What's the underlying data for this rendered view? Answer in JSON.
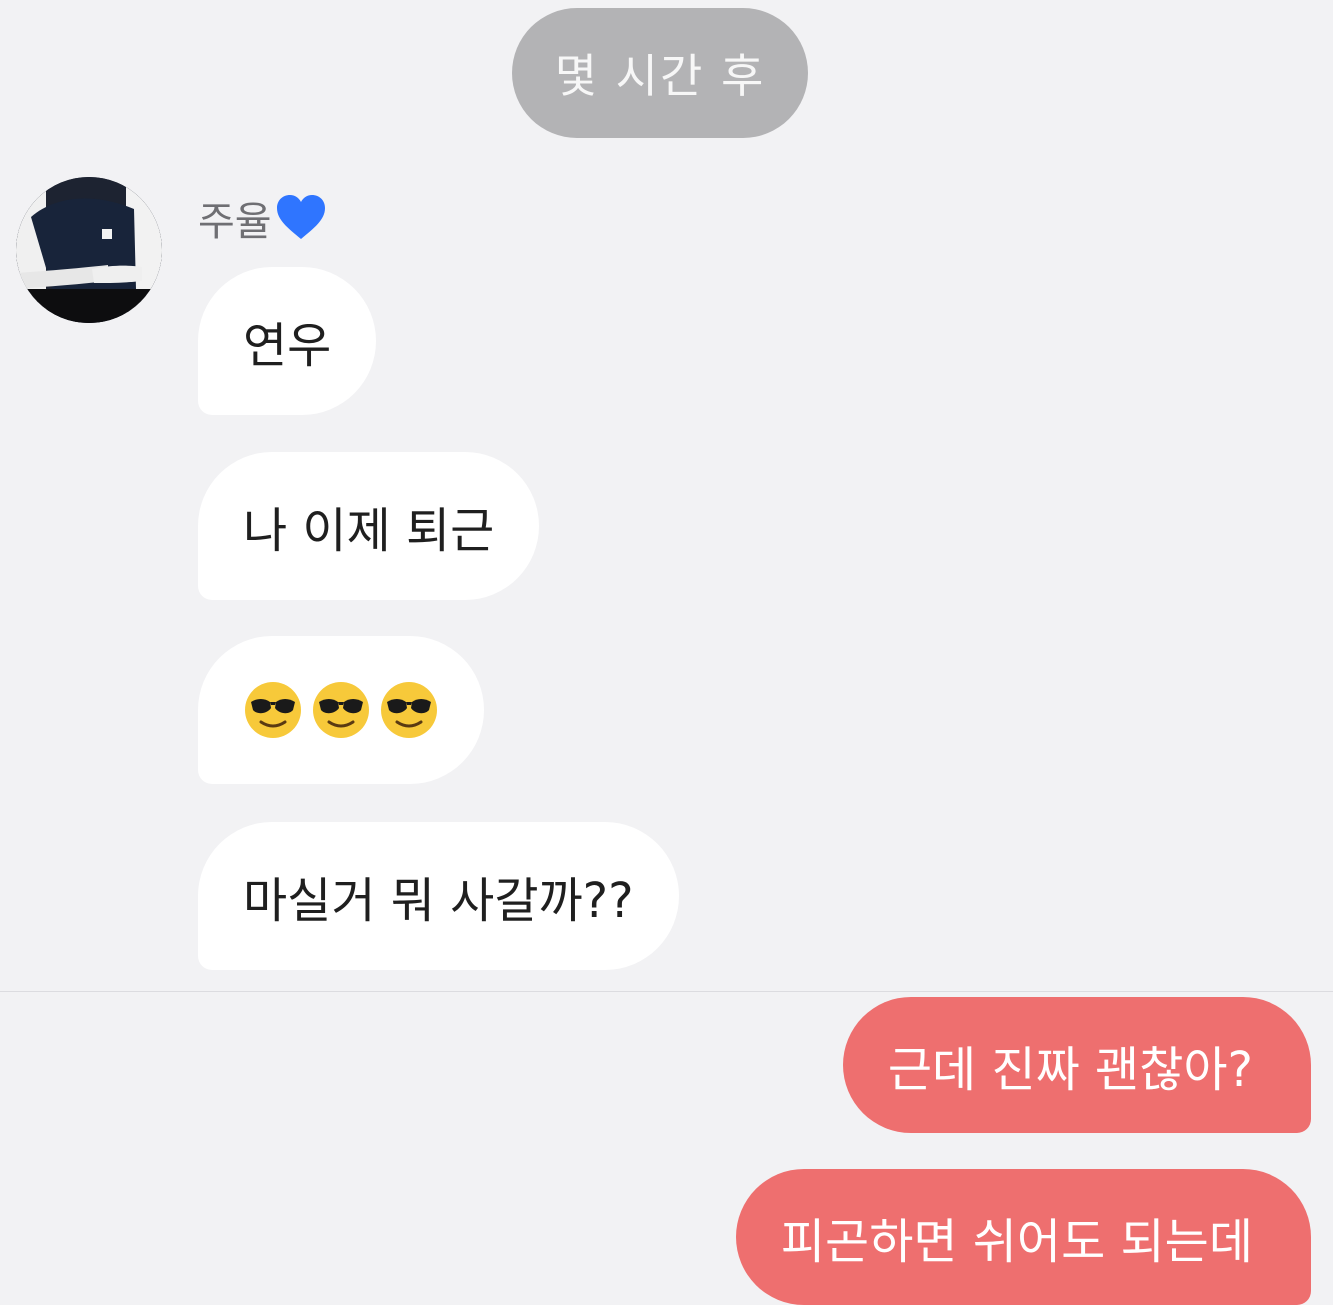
{
  "timestamp_label": "몇 시간 후",
  "sender": {
    "name": "주율",
    "heart_color": "#2f75ff"
  },
  "messages": [
    {
      "direction": "incoming",
      "text": "연우"
    },
    {
      "direction": "incoming",
      "text": "나 이제 퇴근"
    },
    {
      "direction": "incoming",
      "text": "😎😎😎"
    },
    {
      "direction": "incoming",
      "text": "마실거 뭐 사갈까??"
    },
    {
      "direction": "outgoing",
      "text": "근데 진짜 괜찮아?"
    },
    {
      "direction": "outgoing",
      "text": "피곤하면 쉬어도 되는데"
    }
  ],
  "colors": {
    "background": "#f2f2f4",
    "incoming_bubble": "#ffffff",
    "outgoing_bubble": "#ee6f6f",
    "timestamp_pill": "#b3b3b5"
  }
}
